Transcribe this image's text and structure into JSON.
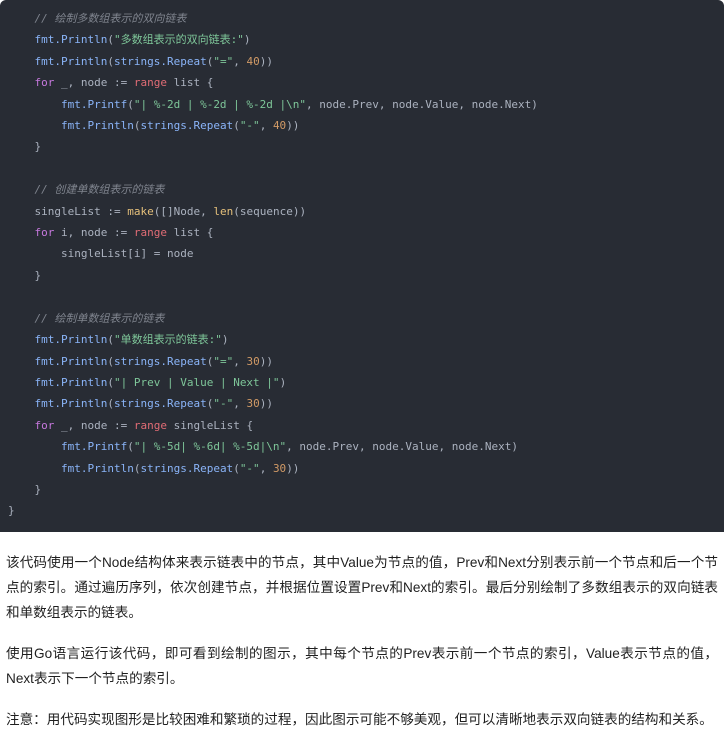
{
  "code_block": {
    "language": "go",
    "theme": {
      "background": "#282c34",
      "default_text": "#abb2bf",
      "comment": "#7f848e",
      "string": "#7ec699",
      "number": "#d19a66",
      "keyword": "#c678dd",
      "keyword_alt": "#e06c75",
      "builtin": "#e5c07b",
      "function": "#8ab4f8"
    },
    "lines": [
      {
        "indent": 1,
        "tokens": [
          {
            "t": "com",
            "v": "// 绘制多数组表示的双向链表"
          }
        ]
      },
      {
        "indent": 1,
        "tokens": [
          {
            "t": "fn",
            "v": "fmt.Println"
          },
          {
            "t": "punc",
            "v": "("
          },
          {
            "t": "str",
            "v": "\"多数组表示的双向链表:\""
          },
          {
            "t": "punc",
            "v": ")"
          }
        ]
      },
      {
        "indent": 1,
        "tokens": [
          {
            "t": "fn",
            "v": "fmt.Println"
          },
          {
            "t": "punc",
            "v": "("
          },
          {
            "t": "fn",
            "v": "strings.Repeat"
          },
          {
            "t": "punc",
            "v": "("
          },
          {
            "t": "str",
            "v": "\"=\""
          },
          {
            "t": "punc",
            "v": ", "
          },
          {
            "t": "num",
            "v": "40"
          },
          {
            "t": "punc",
            "v": "))"
          }
        ]
      },
      {
        "indent": 1,
        "tokens": [
          {
            "t": "kw",
            "v": "for"
          },
          {
            "t": "var",
            "v": " _, node "
          },
          {
            "t": "op",
            "v": ":= "
          },
          {
            "t": "kw2",
            "v": "range"
          },
          {
            "t": "var",
            "v": " list "
          },
          {
            "t": "brace",
            "v": "{"
          }
        ]
      },
      {
        "indent": 2,
        "tokens": [
          {
            "t": "fn",
            "v": "fmt.Printf"
          },
          {
            "t": "punc",
            "v": "("
          },
          {
            "t": "str",
            "v": "\"| %-2d | %-2d | %-2d |\\n\""
          },
          {
            "t": "punc",
            "v": ", "
          },
          {
            "t": "var",
            "v": "node.Prev, node.Value, node.Next"
          },
          {
            "t": "punc",
            "v": ")"
          }
        ]
      },
      {
        "indent": 2,
        "tokens": [
          {
            "t": "fn",
            "v": "fmt.Println"
          },
          {
            "t": "punc",
            "v": "("
          },
          {
            "t": "fn",
            "v": "strings.Repeat"
          },
          {
            "t": "punc",
            "v": "("
          },
          {
            "t": "str",
            "v": "\"-\""
          },
          {
            "t": "punc",
            "v": ", "
          },
          {
            "t": "num",
            "v": "40"
          },
          {
            "t": "punc",
            "v": "))"
          }
        ]
      },
      {
        "indent": 1,
        "tokens": [
          {
            "t": "brace",
            "v": "}"
          }
        ]
      },
      {
        "indent": 0,
        "tokens": []
      },
      {
        "indent": 1,
        "tokens": [
          {
            "t": "com",
            "v": "// 创建单数组表示的链表"
          }
        ]
      },
      {
        "indent": 1,
        "tokens": [
          {
            "t": "var",
            "v": "singleList "
          },
          {
            "t": "op",
            "v": ":= "
          },
          {
            "t": "bi",
            "v": "make"
          },
          {
            "t": "punc",
            "v": "([]"
          },
          {
            "t": "type",
            "v": "Node"
          },
          {
            "t": "punc",
            "v": ", "
          },
          {
            "t": "bi",
            "v": "len"
          },
          {
            "t": "punc",
            "v": "("
          },
          {
            "t": "var",
            "v": "sequence"
          },
          {
            "t": "punc",
            "v": "))"
          }
        ]
      },
      {
        "indent": 1,
        "tokens": [
          {
            "t": "kw",
            "v": "for"
          },
          {
            "t": "var",
            "v": " i, node "
          },
          {
            "t": "op",
            "v": ":= "
          },
          {
            "t": "kw2",
            "v": "range"
          },
          {
            "t": "var",
            "v": " list "
          },
          {
            "t": "brace",
            "v": "{"
          }
        ]
      },
      {
        "indent": 2,
        "tokens": [
          {
            "t": "var",
            "v": "singleList[i] = node"
          }
        ]
      },
      {
        "indent": 1,
        "tokens": [
          {
            "t": "brace",
            "v": "}"
          }
        ]
      },
      {
        "indent": 0,
        "tokens": []
      },
      {
        "indent": 1,
        "tokens": [
          {
            "t": "com",
            "v": "// 绘制单数组表示的链表"
          }
        ]
      },
      {
        "indent": 1,
        "tokens": [
          {
            "t": "fn",
            "v": "fmt.Println"
          },
          {
            "t": "punc",
            "v": "("
          },
          {
            "t": "str",
            "v": "\"单数组表示的链表:\""
          },
          {
            "t": "punc",
            "v": ")"
          }
        ]
      },
      {
        "indent": 1,
        "tokens": [
          {
            "t": "fn",
            "v": "fmt.Println"
          },
          {
            "t": "punc",
            "v": "("
          },
          {
            "t": "fn",
            "v": "strings.Repeat"
          },
          {
            "t": "punc",
            "v": "("
          },
          {
            "t": "str",
            "v": "\"=\""
          },
          {
            "t": "punc",
            "v": ", "
          },
          {
            "t": "num",
            "v": "30"
          },
          {
            "t": "punc",
            "v": "))"
          }
        ]
      },
      {
        "indent": 1,
        "tokens": [
          {
            "t": "fn",
            "v": "fmt.Println"
          },
          {
            "t": "punc",
            "v": "("
          },
          {
            "t": "str",
            "v": "\"| Prev | Value | Next |\""
          },
          {
            "t": "punc",
            "v": ")"
          }
        ]
      },
      {
        "indent": 1,
        "tokens": [
          {
            "t": "fn",
            "v": "fmt.Println"
          },
          {
            "t": "punc",
            "v": "("
          },
          {
            "t": "fn",
            "v": "strings.Repeat"
          },
          {
            "t": "punc",
            "v": "("
          },
          {
            "t": "str",
            "v": "\"-\""
          },
          {
            "t": "punc",
            "v": ", "
          },
          {
            "t": "num",
            "v": "30"
          },
          {
            "t": "punc",
            "v": "))"
          }
        ]
      },
      {
        "indent": 1,
        "tokens": [
          {
            "t": "kw",
            "v": "for"
          },
          {
            "t": "var",
            "v": " _, node "
          },
          {
            "t": "op",
            "v": ":= "
          },
          {
            "t": "kw2",
            "v": "range"
          },
          {
            "t": "var",
            "v": " singleList "
          },
          {
            "t": "brace",
            "v": "{"
          }
        ]
      },
      {
        "indent": 2,
        "tokens": [
          {
            "t": "fn",
            "v": "fmt.Printf"
          },
          {
            "t": "punc",
            "v": "("
          },
          {
            "t": "str",
            "v": "\"| %-5d| %-6d| %-5d|\\n\""
          },
          {
            "t": "punc",
            "v": ", "
          },
          {
            "t": "var",
            "v": "node.Prev, node.Value, node.Next"
          },
          {
            "t": "punc",
            "v": ")"
          }
        ]
      },
      {
        "indent": 2,
        "tokens": [
          {
            "t": "fn",
            "v": "fmt.Println"
          },
          {
            "t": "punc",
            "v": "("
          },
          {
            "t": "fn",
            "v": "strings.Repeat"
          },
          {
            "t": "punc",
            "v": "("
          },
          {
            "t": "str",
            "v": "\"-\""
          },
          {
            "t": "punc",
            "v": ", "
          },
          {
            "t": "num",
            "v": "30"
          },
          {
            "t": "punc",
            "v": "))"
          }
        ]
      },
      {
        "indent": 1,
        "tokens": [
          {
            "t": "brace",
            "v": "}"
          }
        ]
      },
      {
        "indent": 0,
        "tokens": [
          {
            "t": "brace",
            "v": "}"
          }
        ]
      }
    ]
  },
  "explanation": {
    "paragraph_1": "该代码使用一个Node结构体来表示链表中的节点，其中Value为节点的值，Prev和Next分别表示前一个节点和后一个节点的索引。通过遍历序列，依次创建节点，并根据位置设置Prev和Next的索引。最后分别绘制了多数组表示的双向链表和单数组表示的链表。",
    "paragraph_2": "使用Go语言运行该代码，即可看到绘制的图示，其中每个节点的Prev表示前一个节点的索引，Value表示节点的值，Next表示下一个节点的索引。",
    "paragraph_3": "注意：用代码实现图形是比较困难和繁琐的过程，因此图示可能不够美观，但可以清晰地表示双向链表的结构和关系。"
  }
}
